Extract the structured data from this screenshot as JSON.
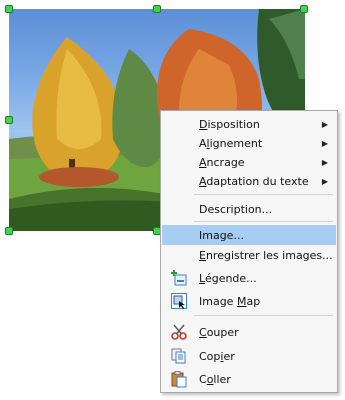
{
  "menu": {
    "items": [
      {
        "label": "Disposition",
        "accel": "D",
        "submenu": true
      },
      {
        "label": "Alignement",
        "accel": "l",
        "submenu": true
      },
      {
        "label": "Ancrage",
        "accel": "A",
        "submenu": true
      },
      {
        "label": "Adaptation du texte",
        "accel": "A",
        "submenu": true
      },
      {
        "label": "Description...",
        "accel": "",
        "submenu": false
      },
      {
        "label": "Image...",
        "accel": "",
        "submenu": false,
        "highlighted": true
      },
      {
        "label": "Enregistrer les images...",
        "accel": "E",
        "submenu": false
      },
      {
        "label": "Légende...",
        "accel": "L",
        "submenu": false,
        "icon": "caption-icon"
      },
      {
        "label": "Image Map",
        "accel": "M",
        "submenu": false,
        "icon": "image-map-icon"
      },
      {
        "label": "Couper",
        "accel": "C",
        "submenu": false,
        "icon": "scissors-icon"
      },
      {
        "label": "Copier",
        "accel": "i",
        "submenu": false,
        "icon": "copy-icon"
      },
      {
        "label": "Coller",
        "accel": "o",
        "submenu": false,
        "icon": "paste-icon"
      }
    ]
  },
  "colors": {
    "highlight": "#a8cdf3",
    "handle": "#3fd54d"
  }
}
